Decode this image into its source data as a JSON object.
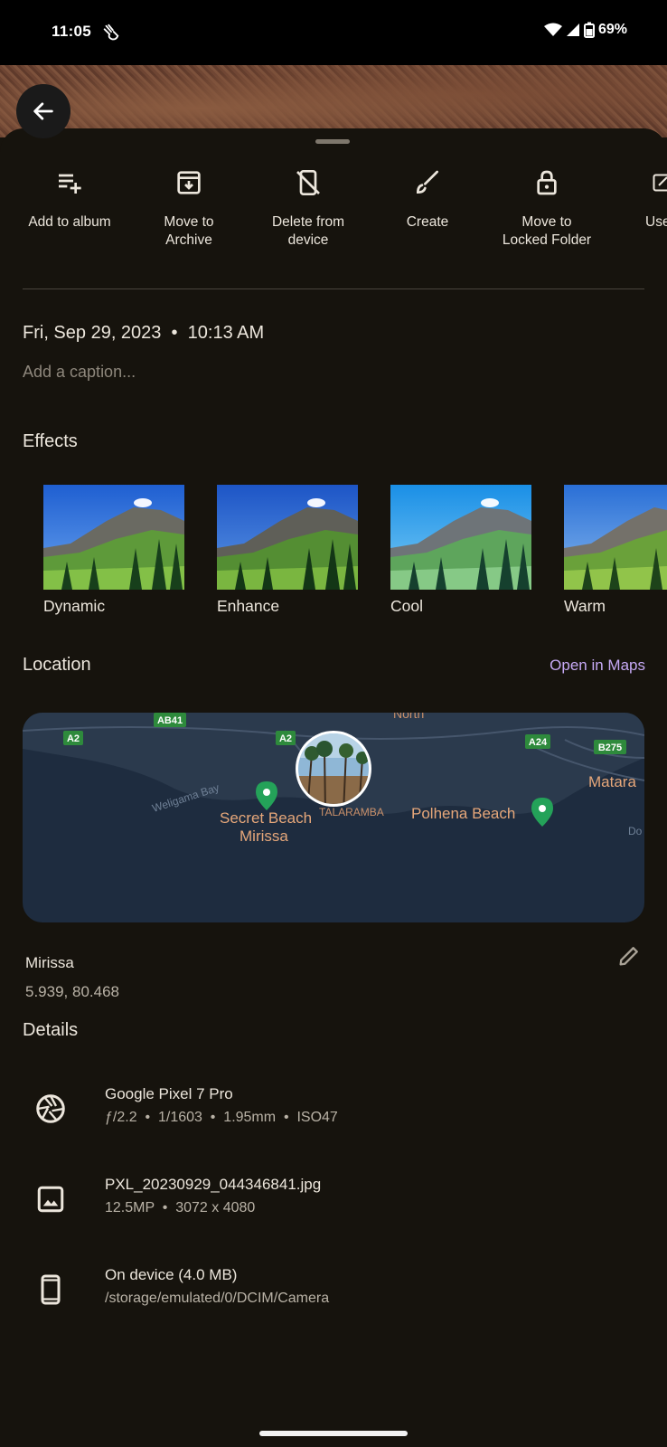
{
  "status": {
    "time": "11:05",
    "battery": "69%"
  },
  "actions": [
    {
      "label": "Add to album",
      "icon": "playlist-add-icon"
    },
    {
      "label": "Move to\nArchive",
      "icon": "archive-icon"
    },
    {
      "label": "Delete from\ndevice",
      "icon": "delete-device-icon"
    },
    {
      "label": "Create",
      "icon": "brush-icon"
    },
    {
      "label": "Move to\nLocked Folder",
      "icon": "lock-icon"
    },
    {
      "label": "Use",
      "icon": "open-in-icon"
    }
  ],
  "info": {
    "date": "Fri, Sep 29, 2023  •  10:13 AM",
    "caption_placeholder": "Add a caption..."
  },
  "effects": {
    "title": "Effects",
    "items": [
      "Dynamic",
      "Enhance",
      "Cool",
      "Warm"
    ]
  },
  "location": {
    "title": "Location",
    "open_maps": "Open in Maps",
    "place": "Mirissa",
    "coords": "5.939, 80.468",
    "map_labels": {
      "ab41": "AB41",
      "a2_left": "A2",
      "a2_mid": "A2",
      "a24": "A24",
      "b275": "B275",
      "north": "North",
      "weligama_bay": "Weligama Bay",
      "secret_beach_1": "Secret Beach",
      "secret_beach_2": "Mirissa",
      "talaramba": "TALARAMBA",
      "polhena": "Polhena Beach",
      "matara": "Matara",
      "do": "Do"
    }
  },
  "details": {
    "title": "Details",
    "items": [
      {
        "icon": "camera-aperture-icon",
        "title": "Google Pixel 7 Pro",
        "sub": "ƒ/2.2  •  1/1603  •  1.95mm  •  ISO47"
      },
      {
        "icon": "image-icon",
        "title": "PXL_20230929_044346841.jpg",
        "sub": "12.5MP  •  3072 x 4080"
      },
      {
        "icon": "phone-icon",
        "title": "On device (4.0 MB)",
        "sub": "/storage/emulated/0/DCIM/Camera"
      }
    ]
  }
}
